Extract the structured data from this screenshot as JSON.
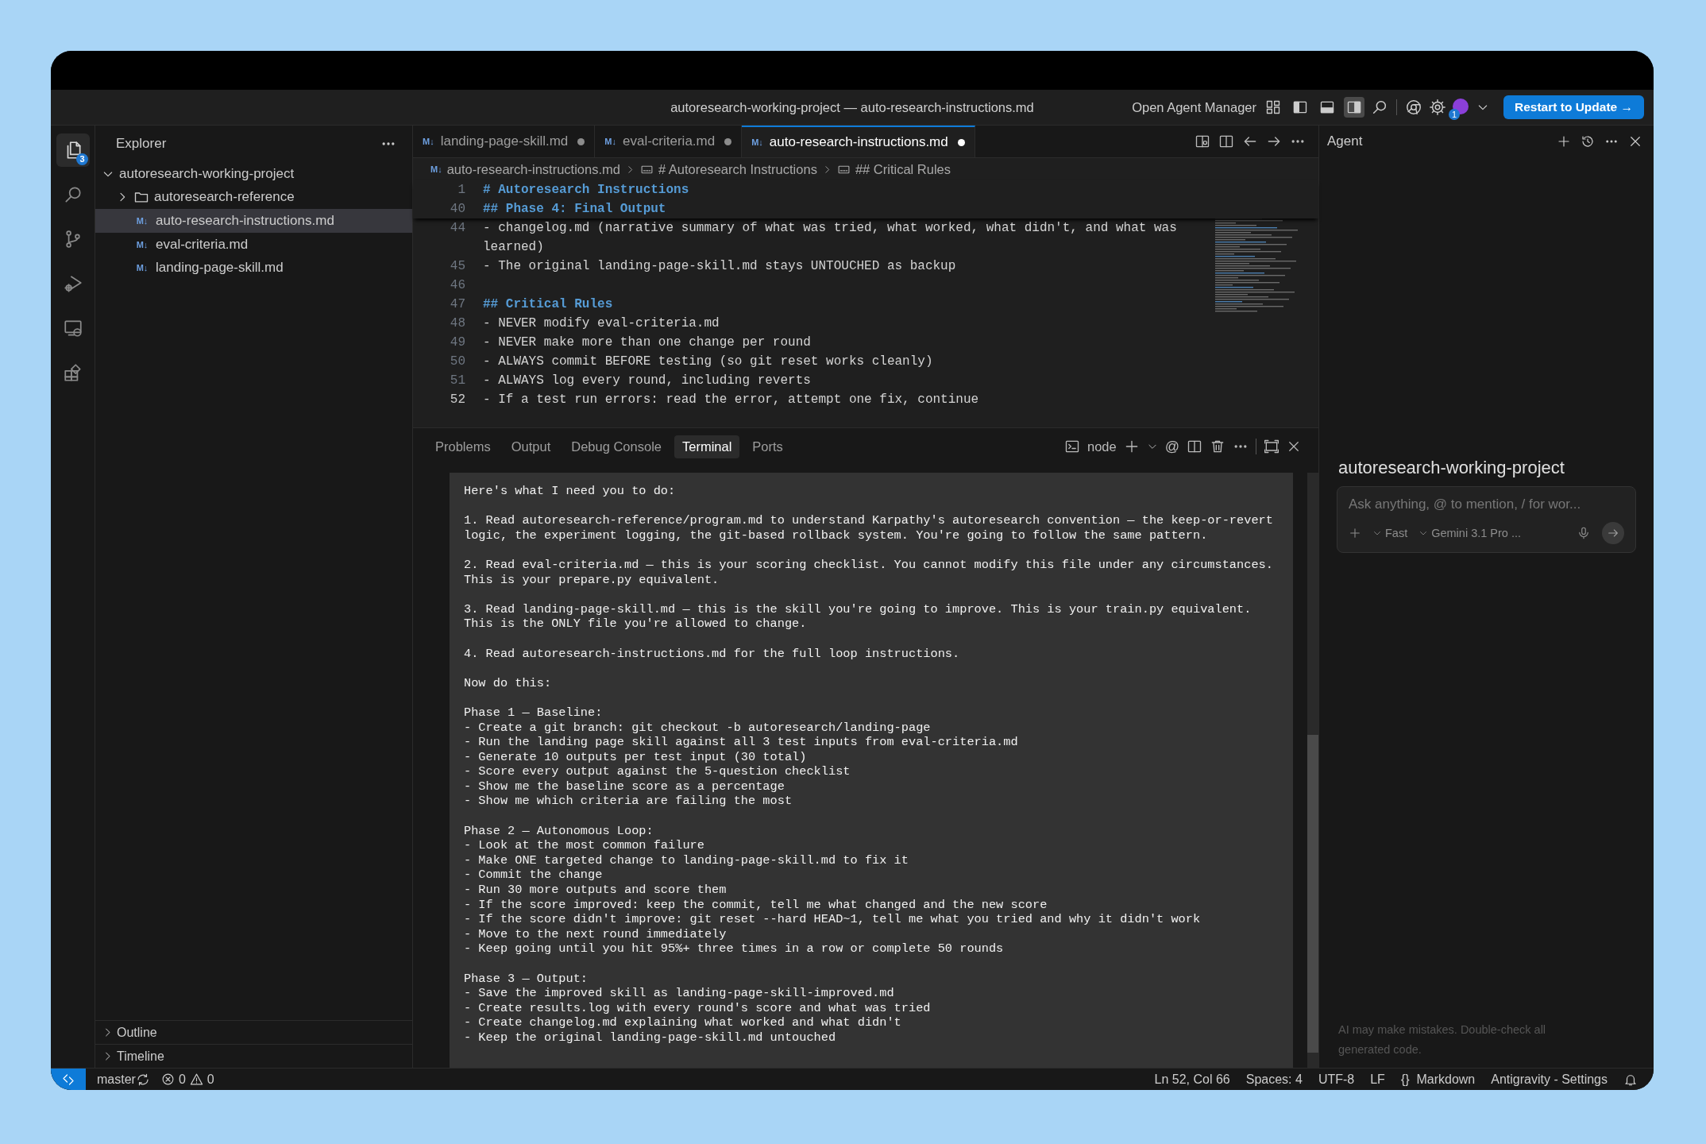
{
  "title_bar": {
    "title": "autoresearch-working-project — auto-research-instructions.md",
    "agent_manager": "Open Agent Manager",
    "layout_toggles": [
      {
        "kind": "customize",
        "on": false
      },
      {
        "kind": "sidebar",
        "on": false
      },
      {
        "kind": "panel",
        "on": false
      },
      {
        "kind": "secondary",
        "on": true
      }
    ],
    "account_badge": "1",
    "update_button": "Restart to Update →"
  },
  "activity_bar": [
    {
      "kind": "explorer",
      "selected": true,
      "badge": "3"
    },
    {
      "kind": "search",
      "selected": false
    },
    {
      "kind": "source-control",
      "selected": false
    },
    {
      "kind": "run-debug",
      "selected": false
    },
    {
      "kind": "remote",
      "selected": false
    },
    {
      "kind": "extensions",
      "selected": false
    }
  ],
  "sidebar": {
    "title": "Explorer",
    "tree": [
      {
        "label": "autoresearch-working-project",
        "kind": "folder",
        "expanded": true,
        "selected": false,
        "children": [
          {
            "label": "autoresearch-reference",
            "kind": "folder",
            "expanded": false,
            "selected": false
          },
          {
            "label": "auto-research-instructions.md",
            "kind": "file",
            "icon": "M↓",
            "selected": true
          },
          {
            "label": "eval-criteria.md",
            "kind": "file",
            "icon": "M↓",
            "selected": false
          },
          {
            "label": "landing-page-skill.md",
            "kind": "file",
            "icon": "M↓",
            "selected": false
          }
        ]
      }
    ],
    "sections": [
      {
        "label": "Outline",
        "expanded": false
      },
      {
        "label": "Timeline",
        "expanded": false
      }
    ]
  },
  "editor": {
    "tabs": [
      {
        "label": "landing-page-skill.md",
        "icon": "M↓",
        "modified": true,
        "selected": false
      },
      {
        "label": "eval-criteria.md",
        "icon": "M↓",
        "modified": true,
        "selected": false
      },
      {
        "label": "auto-research-instructions.md",
        "icon": "M↓",
        "modified": true,
        "selected": true
      }
    ],
    "breadcrumb": [
      {
        "label": "auto-research-instructions.md",
        "kind": "file",
        "icon": "M↓"
      },
      {
        "label": "# Autoresearch Instructions",
        "kind": "symbol"
      },
      {
        "label": "## Critical Rules",
        "kind": "symbol"
      }
    ],
    "sticky_lines": [
      {
        "number": "1",
        "text": "# Autoresearch Instructions",
        "kind": "heading"
      },
      {
        "number": "40",
        "text": "## Phase 4: Final Output",
        "kind": "heading"
      }
    ],
    "lines": [
      {
        "number": "44",
        "text": "- changelog.md (narrative summary of what was tried, what worked, what didn't, and what was learned)",
        "kind": "text",
        "current": false
      },
      {
        "number": "45",
        "text": "- The original landing-page-skill.md stays UNTOUCHED as backup",
        "kind": "text",
        "current": false
      },
      {
        "number": "46",
        "kind": "blank",
        "current": false
      },
      {
        "number": "47",
        "text": "## Critical Rules",
        "kind": "heading",
        "current": false
      },
      {
        "number": "48",
        "text": "- NEVER modify eval-criteria.md",
        "kind": "text",
        "current": false
      },
      {
        "number": "49",
        "text": "- NEVER make more than one change per round",
        "kind": "text",
        "current": false
      },
      {
        "number": "50",
        "text": "- ALWAYS commit BEFORE testing (so git reset works cleanly)",
        "kind": "text",
        "current": false
      },
      {
        "number": "51",
        "text": "- ALWAYS log every round, including reverts",
        "kind": "text",
        "current": false
      },
      {
        "number": "52",
        "text": "- If a test run errors: read the error, attempt one fix, continue",
        "kind": "text",
        "current": true
      }
    ]
  },
  "panel": {
    "tabs": [
      {
        "label": "Problems",
        "selected": false
      },
      {
        "label": "Output",
        "selected": false
      },
      {
        "label": "Debug Console",
        "selected": false
      },
      {
        "label": "Terminal",
        "selected": true
      },
      {
        "label": "Ports",
        "selected": false
      }
    ],
    "shell": "node",
    "mention": "@",
    "terminal": [
      [
        "Here's what I need you to do:"
      ],
      [
        "1. Read autoresearch-reference/program.md to understand Karpathy's autoresearch convention — the keep-or-revert",
        "logic, the experiment logging, the git-based rollback system. You're going to follow the same pattern."
      ],
      [
        "2. Read eval-criteria.md — this is your scoring checklist. You cannot modify this file under any circumstances.",
        "This is your prepare.py equivalent."
      ],
      [
        "3. Read landing-page-skill.md — this is the skill you're going to improve. This is your train.py equivalent.",
        "This is the ONLY file you're allowed to change."
      ],
      [
        "4. Read autoresearch-instructions.md for the full loop instructions."
      ],
      [
        "Now do this:"
      ],
      [
        "Phase 1 — Baseline:",
        "- Create a git branch: git checkout -b autoresearch/landing-page",
        "- Run the landing page skill against all 3 test inputs from eval-criteria.md",
        "- Generate 10 outputs per test input (30 total)",
        "- Score every output against the 5-question checklist",
        "- Show me the baseline score as a percentage",
        "- Show me which criteria are failing the most"
      ],
      [
        "Phase 2 — Autonomous Loop:",
        "- Look at the most common failure",
        "- Make ONE targeted change to landing-page-skill.md to fix it",
        "- Commit the change",
        "- Run 30 more outputs and score them",
        "- If the score improved: keep the commit, tell me what changed and the new score",
        "- If the score didn't improve: git reset --hard HEAD~1, tell me what you tried and why it didn't work",
        "- Move to the next round immediately",
        "- Keep going until you hit 95%+ three times in a row or complete 50 rounds"
      ],
      [
        "Phase 3 — Output:",
        "- Save the improved skill as landing-page-skill-improved.md",
        "- Create results.log with every round's score and what was tried",
        "- Create changelog.md explaining what worked and what didn't",
        "- Keep the original landing-page-skill.md untouched"
      ]
    ]
  },
  "agent": {
    "title": "Agent",
    "workspace": "autoresearch-working-project",
    "input": {
      "placeholder": "Ask anything, @ to mention, / for wor..."
    },
    "mode": "Fast",
    "model": "Gemini 3.1 Pro ...",
    "disclaimer": "AI may make mistakes. Double-check all generated code."
  },
  "status_bar": {
    "branch": "master",
    "errors": "0",
    "warnings": "0",
    "items": [
      "Ln 52, Col 66",
      "Spaces: 4",
      "UTF-8",
      "LF"
    ],
    "language_icon": "{}",
    "language": "Markdown",
    "settings": "Antigravity - Settings"
  }
}
